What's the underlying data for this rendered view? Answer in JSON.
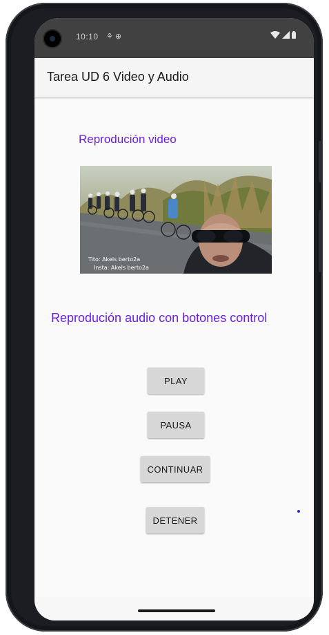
{
  "status_bar": {
    "time": "10:10",
    "left_icons": "⚘ ⊕"
  },
  "app_bar": {
    "title": "Tarea UD 6 Video y Audio"
  },
  "video_section": {
    "heading": "Reprodución video",
    "overlay_line1": "Tito: Akels berto2a",
    "overlay_line2": "Insta: Akels berto2a"
  },
  "audio_section": {
    "heading": "Reprodución audio con botones control",
    "buttons": {
      "play": "PLAY",
      "pause": "PAUSA",
      "resume": "CONTINUAR",
      "stop": "DETENER"
    }
  },
  "colors": {
    "accent_text": "#6a1de0",
    "button_bg": "#d7d7d7",
    "status_bar_bg": "#414141",
    "app_bar_bg": "#f5f5f5"
  }
}
